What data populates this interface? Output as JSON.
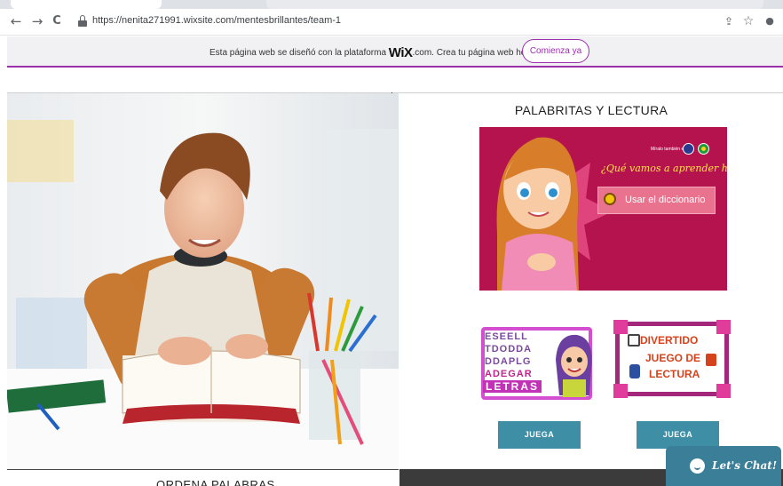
{
  "browser": {
    "url": "https://nenita271991.wixsite.com/mentesbrillantes/team-1",
    "back_icon": "←",
    "forward_icon": "→",
    "reload_icon": "C",
    "share_icon": "⇪",
    "star_icon": "☆",
    "profile_icon": "●"
  },
  "wix_banner": {
    "message_before": "Esta página web se diseñó con la plataforma ",
    "brand": "WiX",
    "message_after": ".com. Crea tu página web hoy.",
    "cta_label": "Comienza ya"
  },
  "left_panel": {
    "image_alt": "Niño leyendo un libro sobre una mesa con lápices de colores",
    "bottom_label": "ORDENA PALABRAS"
  },
  "right_panel": {
    "title": "PALABRITAS Y LECTURA",
    "game": {
      "language_label": "Míralo también en:",
      "question": "¿Qué vamos a aprender hoy?",
      "dictionary_button": "Usar el diccionario"
    },
    "thumbnails": [
      {
        "rows": [
          "ESEELL",
          "TDODDA",
          "DDAPLG",
          "ADEGAR"
        ],
        "banner": "LETRAS"
      },
      {
        "lines": [
          "DIVERTIDO",
          "JUEGO DE",
          "LECTURA"
        ]
      }
    ],
    "play_buttons": [
      "JUEGA",
      "JUEGA"
    ]
  },
  "chat": {
    "label": "Let's Chat!"
  },
  "colors": {
    "wix_accent": "#9b2fae",
    "game_background": "#b5134d",
    "button_teal": "#3e8ea6",
    "chat_teal": "#3a7e97"
  }
}
